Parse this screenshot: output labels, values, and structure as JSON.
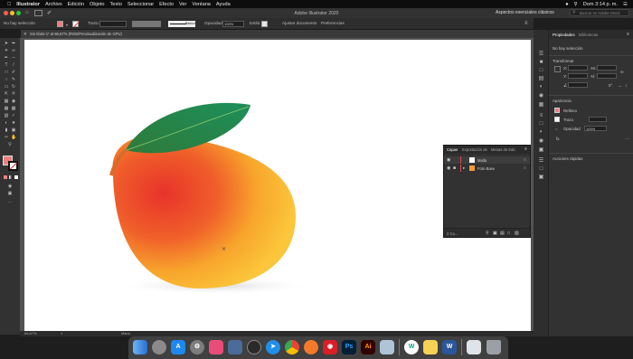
{
  "menubar": {
    "apple": "",
    "app_name": "Illustrator",
    "menus": [
      "Archivo",
      "Edición",
      "Objeto",
      "Texto",
      "Seleccionar",
      "Efecto",
      "Ver",
      "Ventana",
      "Ayuda"
    ],
    "clock": "Dom 3:14 p. m."
  },
  "appbar": {
    "title": "Adobe Illustrator 2020",
    "workspace": "Aspectos esenciales clásicos",
    "search_placeholder": "Buscar en Adobe Stock"
  },
  "controlbar": {
    "selection": "No hay selección",
    "stroke_label": "Trazo:",
    "stroke_style": "Básico",
    "opacity_label": "Opacidad:",
    "opacity_value": "100%",
    "style_label": "Estilo:",
    "doc_setup": "Ajustar documento",
    "preferences": "Preferencias"
  },
  "doc_tab": {
    "title": "Sin título-1* al 66,67% (RGB/Previsualización de GPU)"
  },
  "status": {
    "zoom": "66,67%",
    "artboard": "1",
    "mode": "Mano"
  },
  "right_panel": {
    "tabs": [
      "Propiedades",
      "Bibliotecas"
    ],
    "no_selection": "No hay selección",
    "transform": "Transformar",
    "x_label": "X:",
    "y_label": "Y:",
    "w_label": "An:",
    "h_label": "Al:",
    "angle_value": "0°",
    "appearance": "Apariencia",
    "fill_label": "Relleno",
    "stroke_label": "Trazo",
    "opacity_label": "Opacidad",
    "opacity_value": "100%",
    "fx": "fx.",
    "quick_actions": "Acciones rápidas"
  },
  "layers_panel": {
    "tabs": [
      "Capas",
      "Exportación de",
      "Mesas de trab"
    ],
    "layers": [
      {
        "name": "Malla",
        "selected": true
      },
      {
        "name": "Foto Base",
        "selected": false
      }
    ],
    "footer_count": "2 Ca..."
  },
  "colors": {
    "accent": "#2d8ceb",
    "fill_swatch": "#f08080",
    "layer_marker": "#e04a4a"
  },
  "dock": {
    "apps": [
      {
        "icon": "finder-icon",
        "label": ""
      },
      {
        "icon": "launchpad-icon",
        "label": ""
      },
      {
        "icon": "app-store-icon",
        "label": ""
      },
      {
        "icon": "system-preferences-icon",
        "label": ""
      },
      {
        "icon": "photos-icon",
        "label": ""
      },
      {
        "icon": "screen-recorder-icon",
        "label": ""
      },
      {
        "icon": "quicktime-icon",
        "label": ""
      },
      {
        "icon": "safari-icon",
        "label": ""
      },
      {
        "icon": "chrome-icon",
        "label": ""
      },
      {
        "icon": "blender-icon",
        "label": ""
      },
      {
        "icon": "creative-cloud-icon",
        "label": ""
      },
      {
        "icon": "photoshop-icon",
        "label": "Ps"
      },
      {
        "icon": "illustrator-icon",
        "label": "Ai"
      },
      {
        "icon": "preview-icon",
        "label": ""
      },
      {
        "icon": "webex-icon",
        "label": ""
      },
      {
        "icon": "notes-icon",
        "label": ""
      },
      {
        "icon": "word-icon",
        "label": "W"
      },
      {
        "icon": "screenshot-icon",
        "label": ""
      },
      {
        "icon": "trash-icon",
        "label": ""
      }
    ]
  }
}
